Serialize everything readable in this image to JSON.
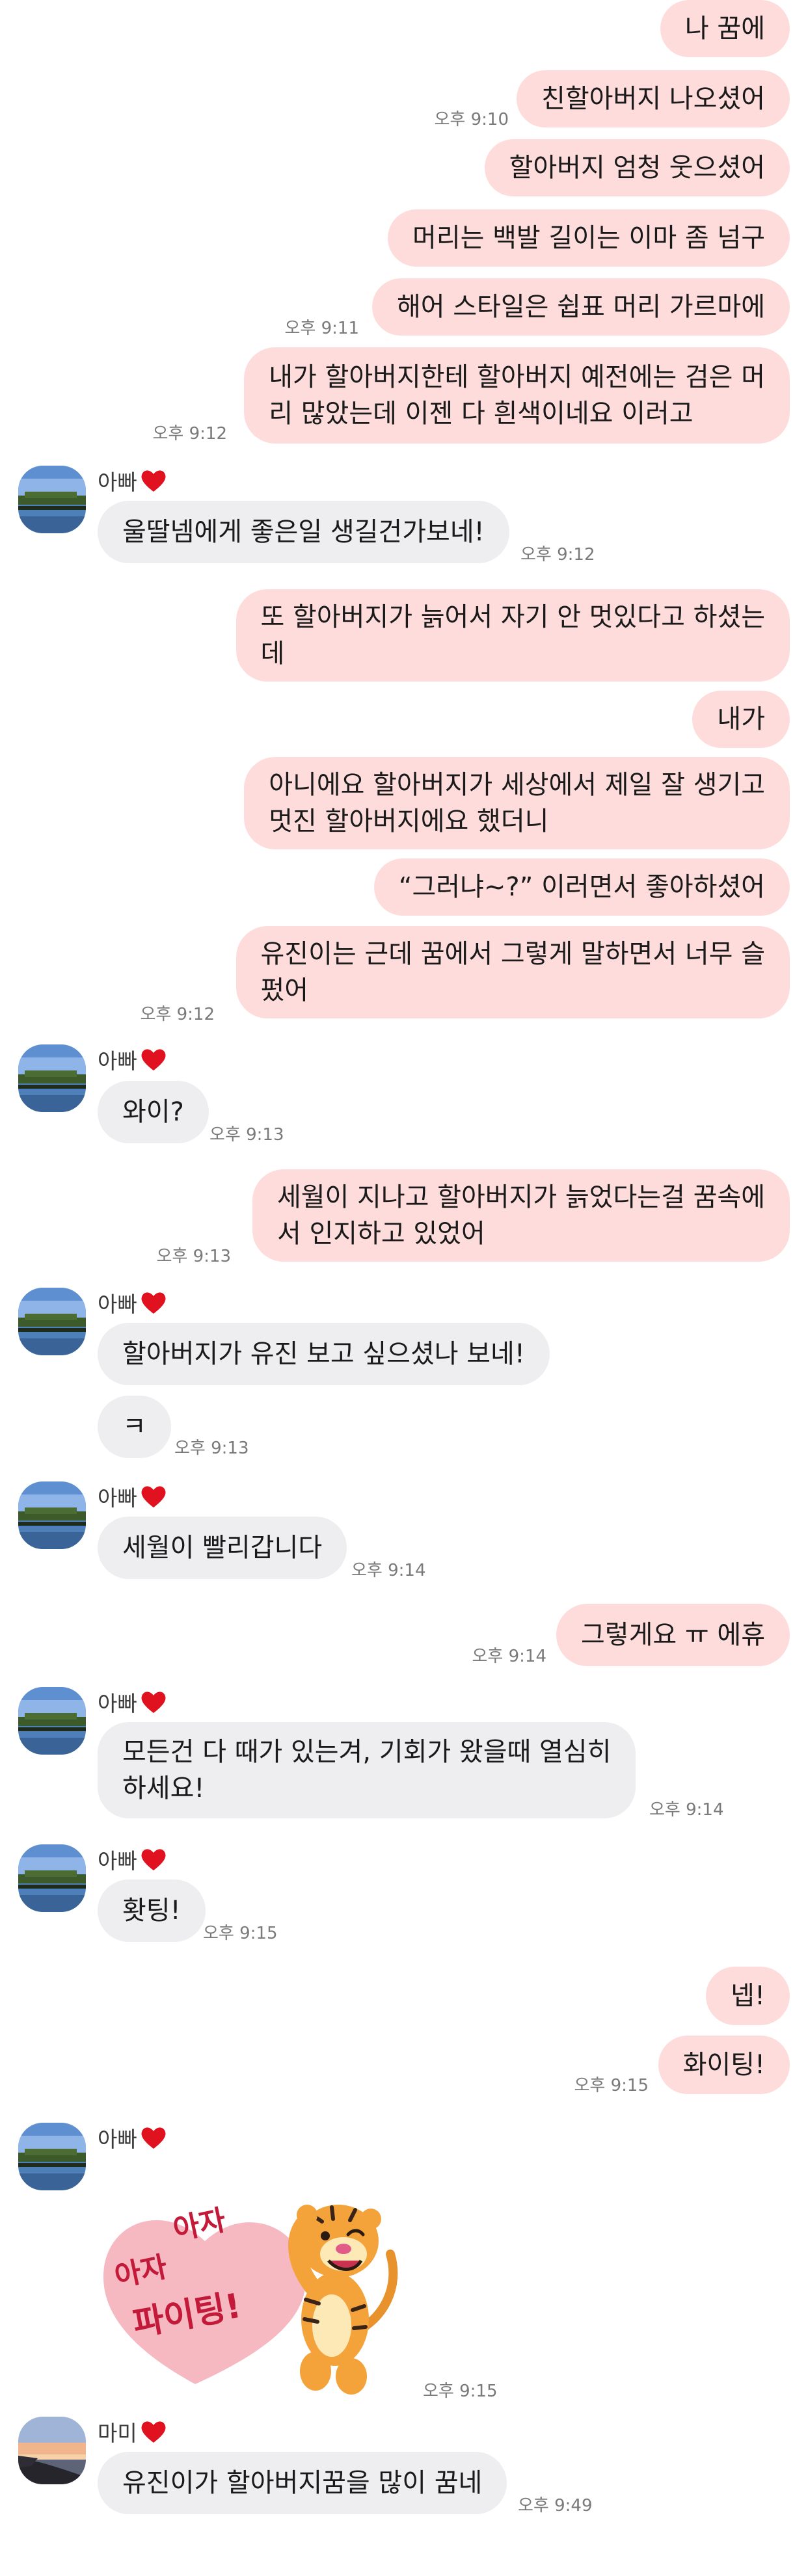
{
  "colors": {
    "outgoing_bubble": "#ffdcdc",
    "incoming_bubble": "#eeeef1",
    "timestamp": "#7a7a7a",
    "heart": "#e0121f"
  },
  "senders": {
    "dad": {
      "name": "아빠",
      "badge": "heart-icon"
    },
    "mom": {
      "name": "마미",
      "badge": "heart-icon"
    }
  },
  "messages": [
    {
      "dir": "out",
      "text": "나 꿈에",
      "time": ""
    },
    {
      "dir": "out",
      "text": "친할아버지 나오셨어",
      "time": "오후 9:10"
    },
    {
      "dir": "out",
      "text": "할아버지 엄청 웃으셨어",
      "time": ""
    },
    {
      "dir": "out",
      "text": "머리는 백발 길이는 이마 좀 넘구",
      "time": ""
    },
    {
      "dir": "out",
      "text": "해어 스타일은 쉽표 머리 가르마에",
      "time": "오후 9:11"
    },
    {
      "dir": "out",
      "text": "내가 할아버지한테 할아버지 예전에는 검은 머\n리 많았는데 이젠 다 흰색이네요 이러고",
      "time": "오후 9:12"
    },
    {
      "dir": "in",
      "sender": "아빠",
      "text": "울딸넴에게 좋은일 생길건가보네!",
      "time": "오후 9:12"
    },
    {
      "dir": "out",
      "text": "또 할아버지가 늙어서 자기 안 멋있다고 하셨는\n데",
      "time": ""
    },
    {
      "dir": "out",
      "text": "내가",
      "time": ""
    },
    {
      "dir": "out",
      "text": "아니에요 할아버지가 세상에서 제일 잘 생기고\n멋진 할아버지에요 했더니",
      "time": ""
    },
    {
      "dir": "out",
      "text": "“그러냐~?” 이러면서 좋아하셨어",
      "time": ""
    },
    {
      "dir": "out",
      "text": "유진이는 근데 꿈에서 그렇게 말하면서 너무 슬\n펐어",
      "time": "오후 9:12"
    },
    {
      "dir": "in",
      "sender": "아빠",
      "text": "와이?",
      "time": "오후 9:13"
    },
    {
      "dir": "out",
      "text": "세월이 지나고 할아버지가 늙었다는걸 꿈속에\n서 인지하고 있었어",
      "time": "오후 9:13"
    },
    {
      "dir": "in",
      "sender": "아빠",
      "text": "할아버지가 유진 보고 싶으셨나 보네!",
      "time": ""
    },
    {
      "dir": "in",
      "text": "ㅋ",
      "time": "오후 9:13"
    },
    {
      "dir": "in",
      "sender": "아빠",
      "text": "세월이 빨리갑니다",
      "time": "오후 9:14"
    },
    {
      "dir": "out",
      "text": "그렇게요 ㅠ 에휴",
      "time": "오후 9:14"
    },
    {
      "dir": "in",
      "sender": "아빠",
      "text": "모든건 다 때가 있는겨, 기회가 왔을때 열심히\n하세요!",
      "time": "오후 9:14"
    },
    {
      "dir": "in",
      "sender": "아빠",
      "text": "홧팅!",
      "time": "오후 9:15"
    },
    {
      "dir": "out",
      "text": "넵!",
      "time": ""
    },
    {
      "dir": "out",
      "text": "화이팅!",
      "time": "오후 9:15"
    },
    {
      "dir": "in",
      "sender": "아빠",
      "sticker": {
        "lines": [
          "아자",
          "아자",
          "파이팅!"
        ],
        "character": "tiger-character"
      },
      "time": "오후 9:15"
    },
    {
      "dir": "in",
      "sender": "마미",
      "text": "유진이가 할아버지꿈을 많이 꿈네",
      "time": "오후 9:49"
    }
  ]
}
